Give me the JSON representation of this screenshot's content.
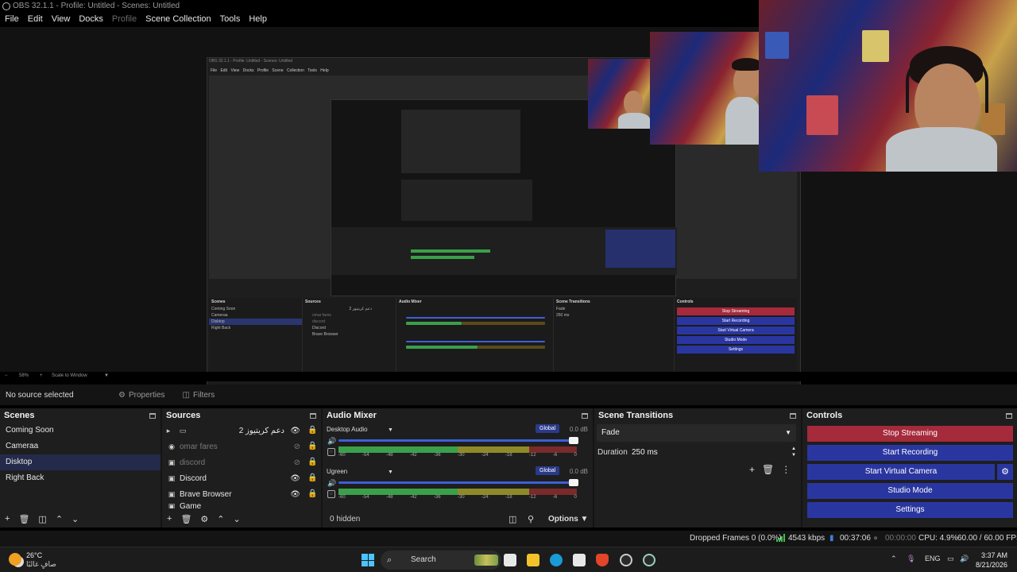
{
  "window": {
    "title": "OBS 32.1.1 - Profile: Untitled - Scenes: Untitled"
  },
  "menu": [
    "File",
    "Edit",
    "View",
    "Docks",
    "Profile",
    "Scene Collection",
    "Tools",
    "Help"
  ],
  "nested_preview": {
    "title": "OBS 32.1.1 - Profile: Untitled - Scenes: Untitled",
    "menu": "File Edit View Docks Profile Scene Collection Tools Help",
    "no_source": "No source selected",
    "properties": "Properties",
    "filters": "Filters",
    "scenes_header": "Scenes",
    "sources_header": "Sources",
    "mixer_header": "Audio Mixer",
    "transitions_header": "Scene Transitions",
    "controls_header": "Controls",
    "zoom": "58%",
    "scale": "Scale to Window",
    "status": "Dropped Frames 0 (0.0%)   4543 kbps   00:37:06   CPU: 4.9%   60.00 / 60.00 FPS"
  },
  "zoom": {
    "value": "58%",
    "mode": "Scale to Window"
  },
  "context": {
    "no_source": "No source selected",
    "properties": "Properties",
    "filters": "Filters"
  },
  "scenes": {
    "header": "Scenes",
    "items": [
      "Coming Soon",
      "Cameraa",
      "Disktop",
      "Right Back"
    ],
    "selected_index": 2
  },
  "sources": {
    "header": "Sources",
    "items": [
      {
        "name": "دعم كريتيوز 2",
        "icon": "folder-icon",
        "visible": true
      },
      {
        "name": "omar fares",
        "icon": "webcam-icon",
        "visible": false
      },
      {
        "name": "discord",
        "icon": "window-icon",
        "visible": false
      },
      {
        "name": "Discord",
        "icon": "window-icon",
        "visible": true
      },
      {
        "name": "Brave Browser",
        "icon": "window-icon",
        "visible": true
      },
      {
        "name": "Game",
        "icon": "window-icon",
        "visible": true
      }
    ]
  },
  "mixer": {
    "header": "Audio Mixer",
    "channels": [
      {
        "name": "Desktop Audio",
        "global": "Global",
        "db": "0.0 dB",
        "volume": 1.0,
        "level": 0.28
      },
      {
        "name": "Ugreen",
        "global": "Global",
        "db": "0.0 dB",
        "volume": 1.0,
        "level": 0.52
      }
    ],
    "ticks": [
      "-60",
      "-54",
      "-48",
      "-42",
      "-36",
      "-30",
      "-24",
      "-18",
      "-12",
      "-6",
      "0"
    ],
    "hidden": "0 hidden",
    "options": "Options"
  },
  "transitions": {
    "header": "Scene Transitions",
    "type": "Fade",
    "duration_label": "Duration",
    "duration": "250 ms"
  },
  "controls": {
    "header": "Controls",
    "stop_streaming": "Stop Streaming",
    "start_recording": "Start Recording",
    "start_virtual_camera": "Start Virtual Camera",
    "studio_mode": "Studio Mode",
    "settings": "Settings"
  },
  "status": {
    "dropped": "Dropped Frames 0 (0.0%)",
    "kbps": "4543 kbps",
    "stream_time": "00:37:06",
    "rec_time": "00:00:00",
    "cpu": "CPU: 4.9%",
    "fps": "60.00 / 60.00 FPS"
  },
  "taskbar": {
    "temp": "26°C",
    "weather": "صافٍ غالبًا",
    "search": "Search",
    "lang": "ENG",
    "time": "3:37 AM",
    "date": "8/21/2026"
  },
  "colors": {
    "accent": "#2a36a0",
    "stop": "#a52a3b",
    "selected": "#242a4a"
  }
}
